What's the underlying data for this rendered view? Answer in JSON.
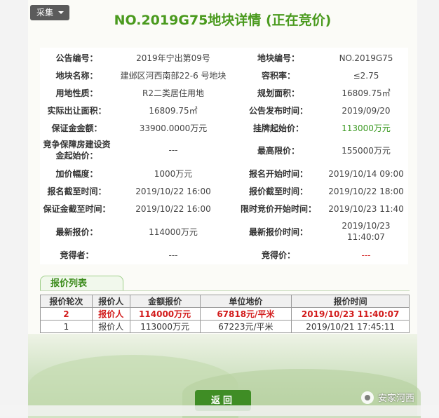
{
  "toolbar": {
    "collect_label": "采集"
  },
  "page": {
    "title": "NO.2019G75地块详情 (正在竞价)"
  },
  "info": [
    {
      "l1": "公告编号：",
      "v1": "2019年宁出第09号",
      "l2": "地块编号：",
      "v2": "NO.2019G75"
    },
    {
      "l1": "地块名称：",
      "v1": "建邺区河西南部22-6 号地块",
      "l2": "容积率：",
      "v2": "≤2.75"
    },
    {
      "l1": "用地性质：",
      "v1": "R2二类居住用地",
      "l2": "规划面积：",
      "v2": "16809.75㎡"
    },
    {
      "l1": "实际出让面积：",
      "v1": "16809.75㎡",
      "l2": "公告发布时间：",
      "v2": "2019/09/20"
    },
    {
      "l1": "保证金金额：",
      "v1": "33900.0000万元",
      "l2": "挂牌起始价：",
      "v2": "113000万元"
    },
    {
      "l1": "竞争保障房建设资金起始价：",
      "v1": "---",
      "l2": "最高限价：",
      "v2": "155000万元"
    },
    {
      "l1": "加价幅度：",
      "v1": "1000万元",
      "l2": "报名开始时间：",
      "v2": "2019/10/14 09:00"
    },
    {
      "l1": "报名截至时间：",
      "v1": "2019/10/22 16:00",
      "l2": "报价截至时间：",
      "v2": "2019/10/22 18:00"
    },
    {
      "l1": "保证金截至时间：",
      "v1": "2019/10/22 16:00",
      "l2": "限时竞价开始时间：",
      "v2": "2019/10/23 11:40"
    },
    {
      "l1": "最新报价：",
      "v1": "114000万元",
      "l2": "最新报价时间：",
      "v2": "2019/10/23 11:40:07"
    },
    {
      "l1": "竞得者：",
      "v1": "---",
      "l2": "竞得价：",
      "v2": "---"
    }
  ],
  "bids": {
    "tab_label": "报价列表",
    "headers": [
      "报价轮次",
      "报价人",
      "金额报价",
      "单位地价",
      "报价时间"
    ],
    "rows": [
      [
        "2",
        "报价人",
        "114000万元",
        "67818元/平米",
        "2019/10/23 11:40:07"
      ],
      [
        "1",
        "报价人",
        "113000万元",
        "67223元/平米",
        "2019/10/21 17:45:11"
      ]
    ]
  },
  "footer": {
    "return_label": "返回",
    "watermark": "安家河西"
  },
  "colors": {
    "accent_green": "#3c9a23",
    "highlight_red": "#d21b1b"
  }
}
